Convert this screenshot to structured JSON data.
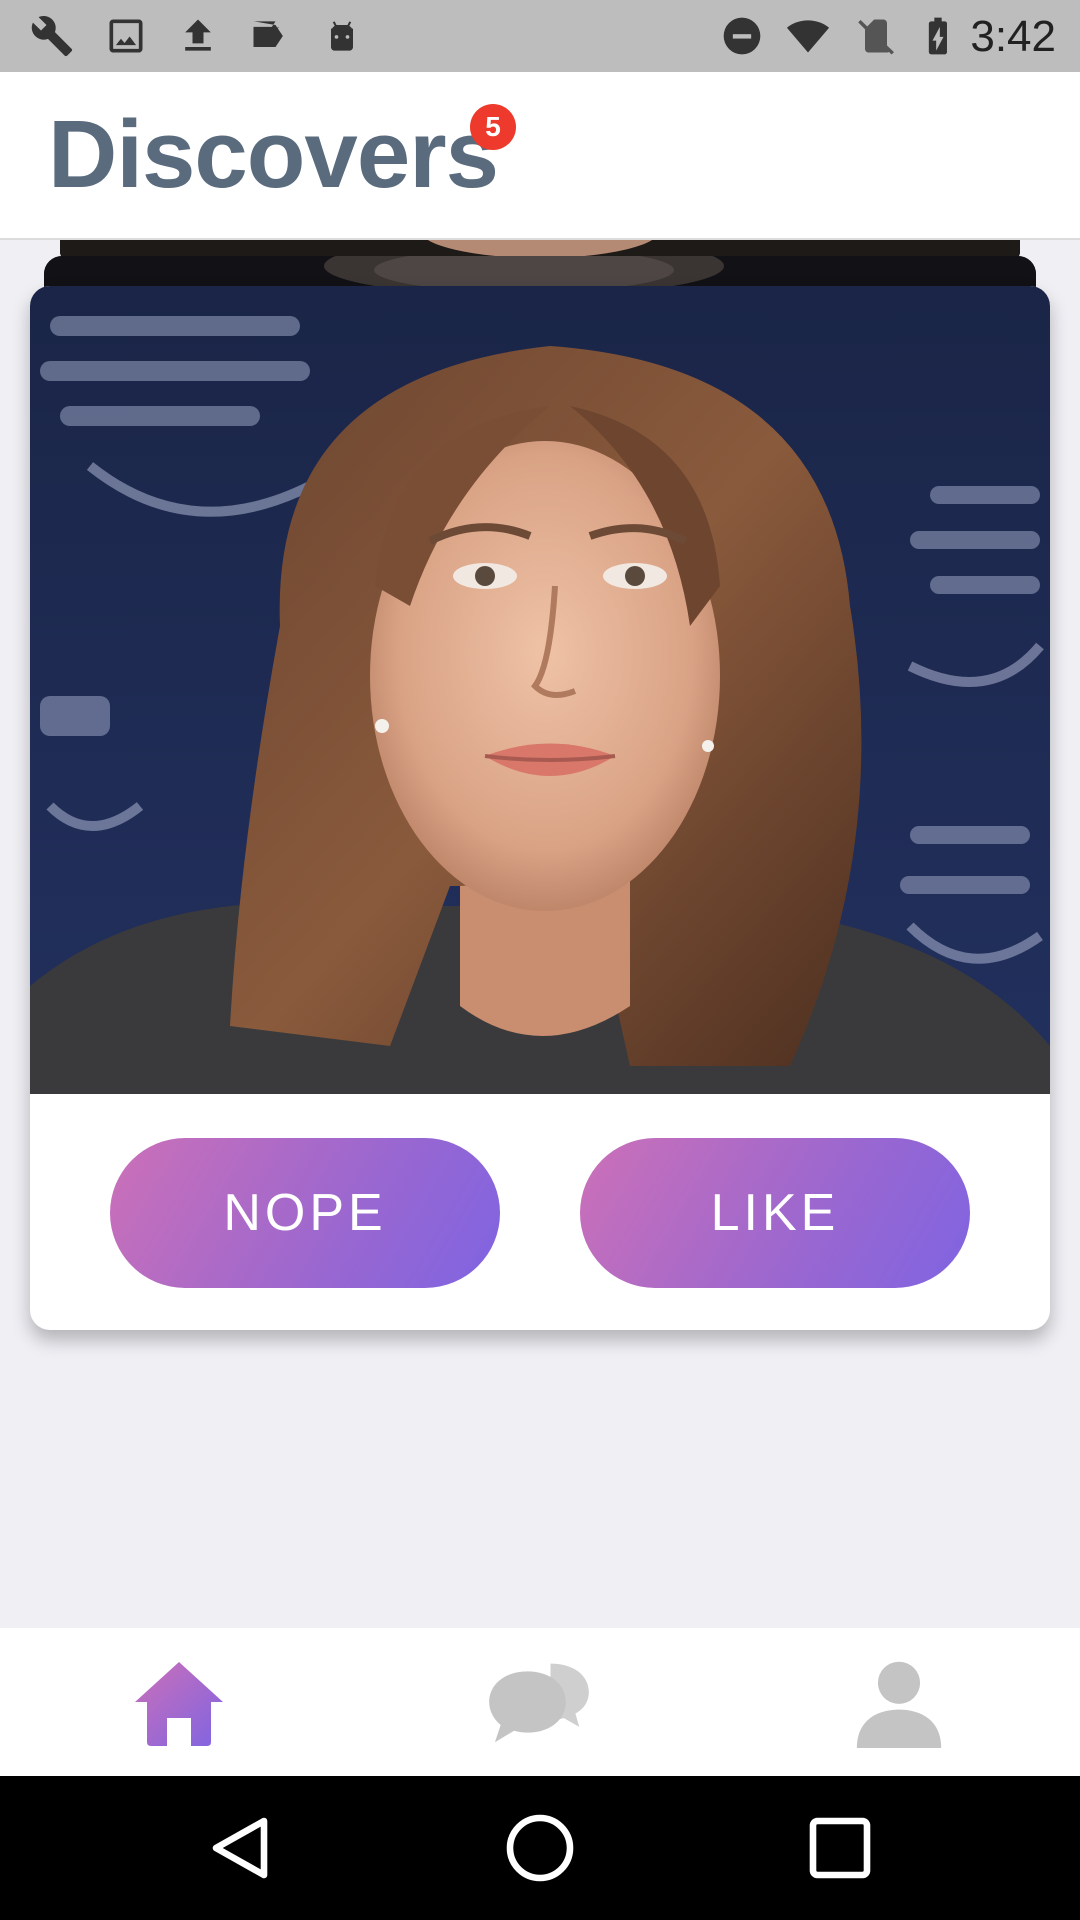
{
  "status_bar": {
    "time": "3:42",
    "left_icons": [
      "wrench-icon",
      "image-icon",
      "upload-icon",
      "checklist-icon",
      "android-icon"
    ],
    "right_icons": [
      "dnd-icon",
      "wifi-icon",
      "no-sim-icon",
      "battery-charging-icon"
    ]
  },
  "header": {
    "title": "Discovers",
    "badge_count": "5"
  },
  "card": {
    "actions": {
      "nope_label": "NOPE",
      "like_label": "LIKE"
    }
  },
  "bottom_nav": {
    "items": [
      {
        "name": "home",
        "icon": "home-icon",
        "active": true
      },
      {
        "name": "chat",
        "icon": "chat-icon",
        "active": false
      },
      {
        "name": "profile",
        "icon": "profile-icon",
        "active": false
      }
    ]
  },
  "system_nav": [
    "back-icon",
    "home-circle-icon",
    "recents-icon"
  ],
  "colors": {
    "accent_start": "#cc70b8",
    "accent_end": "#7f64e2",
    "title": "#5a6b7e",
    "badge": "#ee3a2c",
    "inactive_icon": "#c4c4c4"
  }
}
